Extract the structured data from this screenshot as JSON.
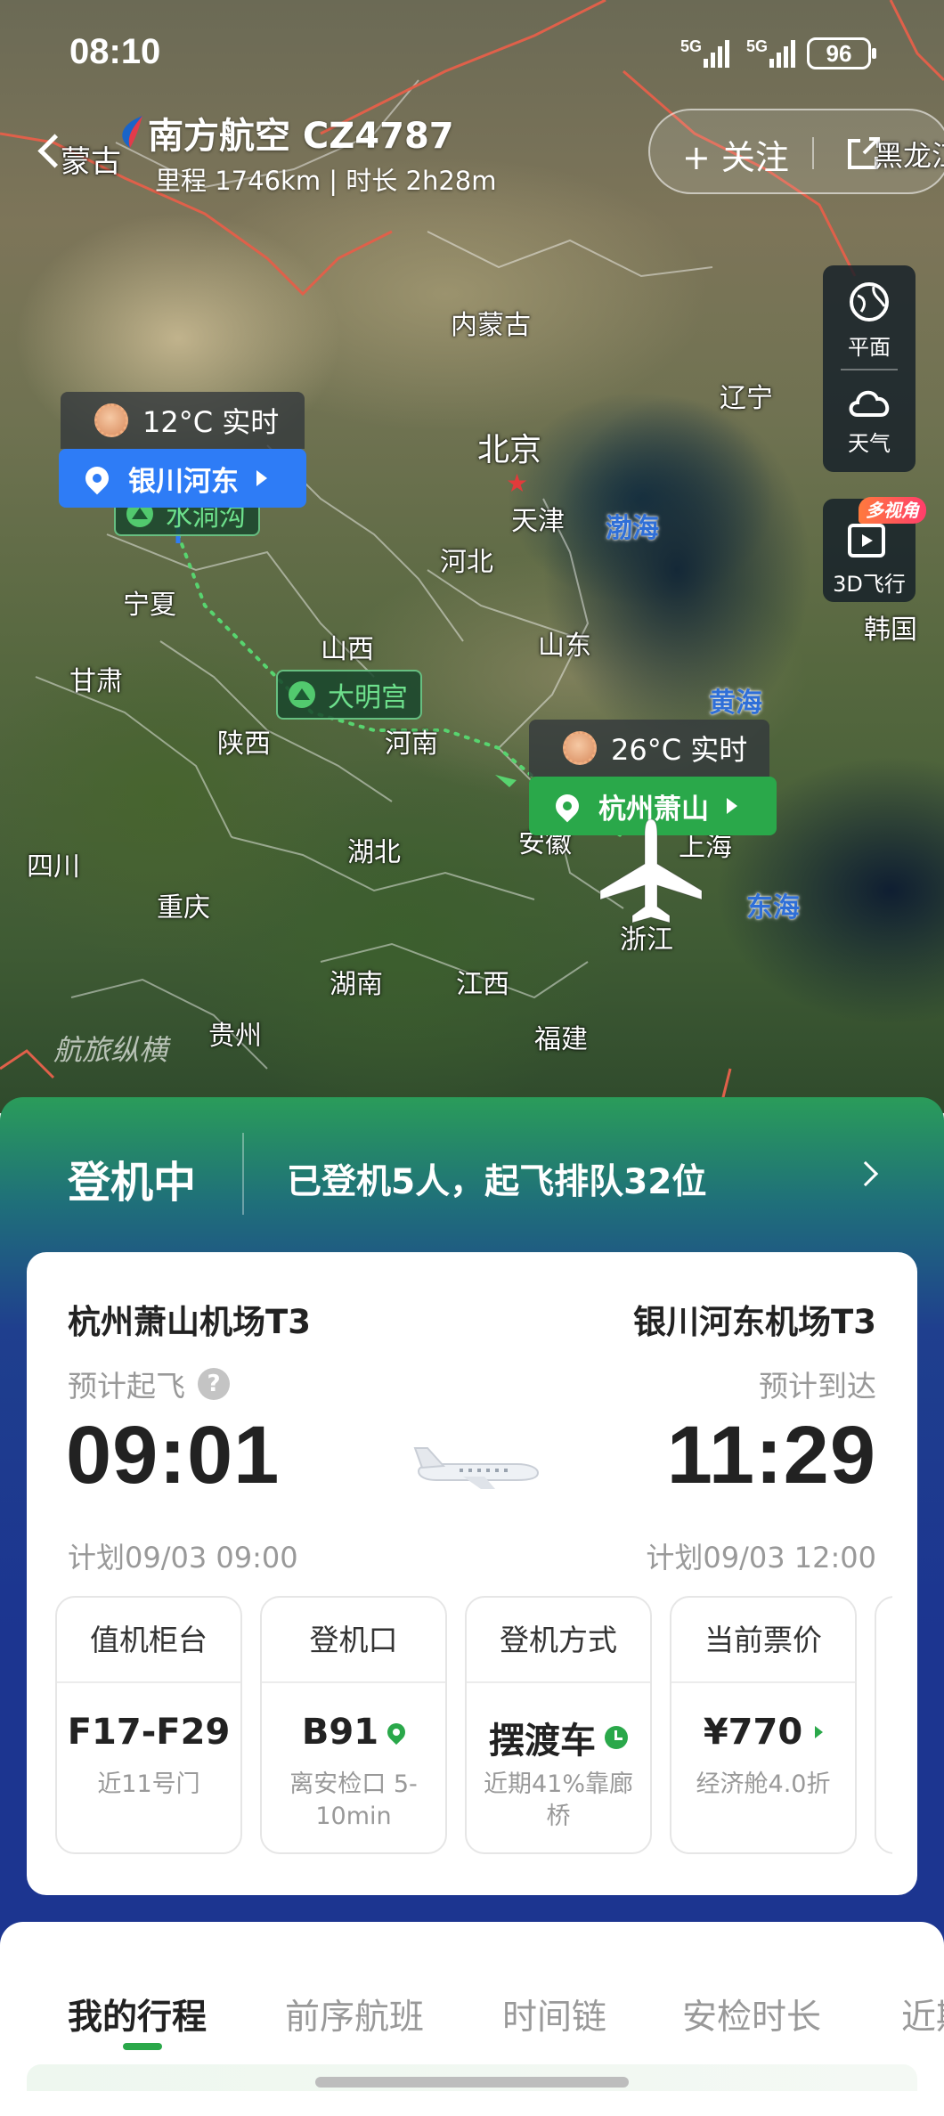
{
  "status_bar": {
    "time": "08:10",
    "network_1": "5G",
    "network_2": "5G",
    "battery": "96"
  },
  "header": {
    "back_region_label": "蒙古",
    "flight_title": "南方航空 CZ4787",
    "flight_subtitle": "里程 1746km | 时长 2h28m",
    "follow_label": "+ 关注",
    "edge_region_label": "黑龙江"
  },
  "map": {
    "regions": [
      "内蒙古",
      "辽宁",
      "北京",
      "天津",
      "河北",
      "宁夏",
      "甘肃",
      "山西",
      "山东",
      "陕西",
      "河南",
      "四川",
      "湖北",
      "安徽",
      "上海",
      "重庆",
      "浙江",
      "湖南",
      "江西",
      "福建",
      "贵州",
      "韩国"
    ],
    "seas": [
      "渤海",
      "黄海",
      "东海"
    ],
    "watermark": "航旅纵横",
    "origin": {
      "weather": "26°C 实时",
      "airport": "杭州萧山"
    },
    "destination": {
      "weather": "12°C 实时",
      "airport": "银川河东"
    },
    "poi": [
      "大明宫",
      "水洞沟"
    ],
    "side_controls": [
      "平面",
      "天气",
      "3D飞行"
    ],
    "side_badge": "多视角"
  },
  "flight_status": {
    "status": "登机中",
    "detail": "已登机5人，起飞排队32位"
  },
  "flight_card": {
    "departure": {
      "airport": "杭州萧山机场T3",
      "label": "预计起飞",
      "time": "09:01",
      "scheduled": "计划09/03 09:00"
    },
    "arrival": {
      "airport": "银川河东机场T3",
      "label": "预计到达",
      "time": "11:29",
      "scheduled": "计划09/03 12:00"
    },
    "tiles": [
      {
        "title": "值机柜台",
        "value": "F17-F29",
        "note": "近11号门"
      },
      {
        "title": "登机口",
        "value": "B91",
        "note": "离安检口 5-10min"
      },
      {
        "title": "登机方式",
        "value": "摆渡车",
        "note": "近期41%靠廊桥"
      },
      {
        "title": "当前票价",
        "value": "¥770",
        "note": "经济舱4.0折"
      }
    ]
  },
  "tabs": [
    "我的行程",
    "前序航班",
    "时间链",
    "安检时长",
    "近期"
  ],
  "colors": {
    "accent_green": "#2aa84a",
    "pill_blue": "#2e7cf6",
    "sheet_blue": "#1c3590",
    "sea_label": "#2f6fd8"
  }
}
